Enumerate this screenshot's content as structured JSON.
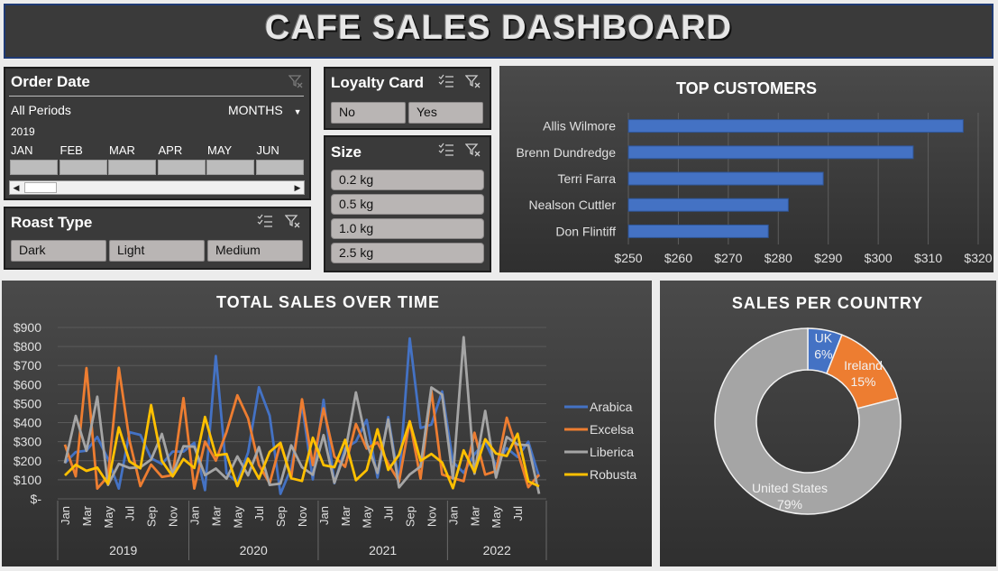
{
  "header": {
    "title": "CAFE SALES DASHBOARD"
  },
  "order_date": {
    "title": "Order Date",
    "period_label": "All Periods",
    "granularity": "MONTHS",
    "year": "2019",
    "months": [
      "JAN",
      "FEB",
      "MAR",
      "APR",
      "MAY",
      "JUN"
    ]
  },
  "loyalty": {
    "title": "Loyalty Card",
    "options": [
      "No",
      "Yes"
    ]
  },
  "size": {
    "title": "Size",
    "options": [
      "0.2 kg",
      "0.5 kg",
      "1.0 kg",
      "2.5 kg"
    ]
  },
  "roast": {
    "title": "Roast Type",
    "options": [
      "Dark",
      "Light",
      "Medium"
    ]
  },
  "icons": {
    "filter_clear": "filter-clear-icon",
    "multiselect": "multiselect-icon",
    "dropdown": "dropdown-arrow-icon"
  },
  "chart_data": [
    {
      "type": "bar",
      "orientation": "horizontal",
      "title": "TOP CUSTOMERS",
      "categories": [
        "Allis Wilmore",
        "Brenn Dundredge",
        "Terri Farra",
        "Nealson Cuttler",
        "Don Flintiff"
      ],
      "values": [
        317,
        307,
        289,
        282,
        278
      ],
      "xlim": [
        250,
        320
      ],
      "ticks": [
        "$250",
        "$260",
        "$270",
        "$280",
        "$290",
        "$300",
        "$310",
        "$320"
      ],
      "color": "#4472c4",
      "grid": true
    },
    {
      "type": "line",
      "title": "TOTAL SALES OVER TIME",
      "x_tick_labels": [
        "Jan",
        "Mar",
        "May",
        "Jul",
        "Sep",
        "Nov",
        "Jan",
        "Mar",
        "May",
        "Jul",
        "Sep",
        "Nov",
        "Jan",
        "Mar",
        "May",
        "Jul",
        "Sep",
        "Nov",
        "Jan",
        "Mar",
        "May",
        "Jul"
      ],
      "years": [
        "2019",
        "2020",
        "2021",
        "2022"
      ],
      "y_ticks": [
        "$-",
        "$100",
        "$200",
        "$300",
        "$400",
        "$500",
        "$600",
        "$700",
        "$800",
        "$900"
      ],
      "ylim": [
        0,
        900
      ],
      "legend_position": "right",
      "series": [
        {
          "name": "Arabica",
          "color": "#4472c4",
          "values": [
            188,
            246,
            253,
            325,
            209,
            54,
            350,
            336,
            213,
            183,
            248,
            248,
            294,
            46,
            750,
            134,
            86,
            244,
            586,
            437,
            26,
            162,
            495,
            102,
            520,
            82,
            265,
            301,
            415,
            112,
            429,
            90,
            842,
            372,
            390,
            564,
            194,
            137,
            235,
            298,
            176,
            266,
            220,
            300,
            115
          ]
        },
        {
          "name": "Excelsa",
          "color": "#ed7d31",
          "values": [
            285,
            118,
            687,
            54,
            118,
            688,
            305,
            67,
            180,
            115,
            124,
            529,
            54,
            301,
            201,
            352,
            544,
            422,
            178,
            81,
            292,
            113,
            523,
            177,
            475,
            222,
            168,
            393,
            264,
            296,
            185,
            90,
            408,
            106,
            569,
            128,
            109,
            93,
            347,
            127,
            146,
            426,
            248,
            61,
            127
          ]
        },
        {
          "name": "Liberica",
          "color": "#a5a5a5",
          "values": [
            187,
            436,
            252,
            536,
            73,
            184,
            162,
            166,
            206,
            341,
            128,
            276,
            274,
            124,
            159,
            106,
            223,
            123,
            272,
            73,
            80,
            281,
            166,
            126,
            335,
            85,
            242,
            559,
            294,
            136,
            417,
            60,
            128,
            170,
            585,
            547,
            107,
            849,
            132,
            462,
            112,
            325,
            285,
            281,
            26
          ]
        },
        {
          "name": "Robusta",
          "color": "#ffc000",
          "values": [
            123,
            179,
            147,
            164,
            78,
            375,
            196,
            160,
            492,
            199,
            118,
            209,
            162,
            430,
            228,
            236,
            67,
            211,
            106,
            246,
            294,
            108,
            94,
            321,
            177,
            166,
            310,
            98,
            151,
            365,
            152,
            231,
            406,
            200,
            236,
            191,
            56,
            255,
            140,
            313,
            238,
            225,
            342,
            92,
            66
          ]
        }
      ]
    },
    {
      "type": "pie",
      "variant": "donut",
      "title": "SALES PER COUNTRY",
      "slices": [
        {
          "label": "UK",
          "pct_label": "6%",
          "value": 6,
          "color": "#4472c4"
        },
        {
          "label": "Ireland",
          "pct_label": "15%",
          "value": 15,
          "color": "#ed7d31"
        },
        {
          "label": "United States",
          "pct_label": "79%",
          "value": 79,
          "color": "#a5a5a5"
        }
      ]
    }
  ]
}
